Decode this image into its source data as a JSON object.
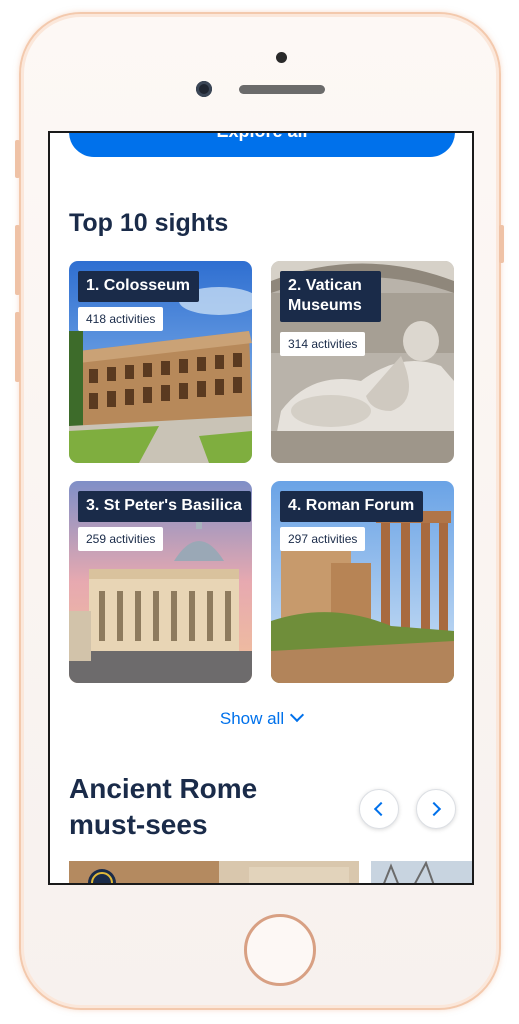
{
  "explore_button": "Explore all",
  "top_sights": {
    "title": "Top 10 sights",
    "cards": [
      {
        "title": "1. Colosseum",
        "count": "418 activities"
      },
      {
        "title": "2. Vatican Museums",
        "count": "314 activities"
      },
      {
        "title": "3. St Peter's Basilica",
        "count": "259 activities"
      },
      {
        "title": "4. Roman Forum",
        "count": "297 activities"
      }
    ],
    "show_all": "Show all"
  },
  "ancient_rome": {
    "title": "Ancient Rome must-sees"
  },
  "colors": {
    "accent": "#0071eb",
    "heading": "#1a2b49",
    "phone_frame": "#f3c9ad"
  },
  "icons": {
    "prev": "chevron-left-icon",
    "next": "chevron-right-icon",
    "show_all": "chevron-down-icon"
  }
}
